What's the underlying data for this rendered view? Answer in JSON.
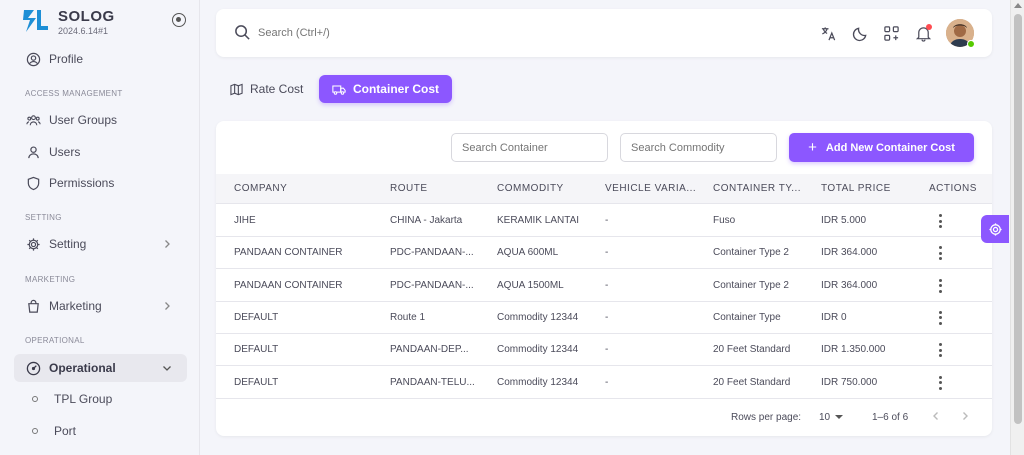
{
  "brand": {
    "name": "SOLOG",
    "version": "2024.6.14#1",
    "logo_text": "SOLOG"
  },
  "sidebar": {
    "items": [
      {
        "label": "Profile",
        "icon": "user-circle-icon"
      },
      {
        "section": "ACCESS MANAGEMENT"
      },
      {
        "label": "User Groups",
        "icon": "users-group-icon"
      },
      {
        "label": "Users",
        "icon": "user-icon"
      },
      {
        "label": "Permissions",
        "icon": "shield-icon"
      },
      {
        "section": "SETTING"
      },
      {
        "label": "Setting",
        "icon": "gear-icon"
      },
      {
        "section": "MARKETING"
      },
      {
        "label": "Marketing",
        "icon": "shopping-bag-icon"
      },
      {
        "section": "OPERATIONAL"
      },
      {
        "label": "Operational",
        "icon": "gauge-icon",
        "active": true
      },
      {
        "label": "TPL Group",
        "sub": true
      },
      {
        "label": "Port",
        "sub": true
      }
    ]
  },
  "topbar": {
    "search_placeholder": "Search (Ctrl+/)"
  },
  "tabs": [
    {
      "label": "Rate Cost",
      "icon": "map-icon",
      "active": false
    },
    {
      "label": "Container Cost",
      "icon": "truck-icon",
      "active": true
    }
  ],
  "filters": {
    "container_placeholder": "Search Container",
    "commodity_placeholder": "Search Commodity",
    "add_button": "Add New Container Cost"
  },
  "table": {
    "columns": [
      "COMPANY",
      "ROUTE",
      "COMMODITY",
      "VEHICLE VARIA...",
      "CONTAINER TY...",
      "TOTAL PRICE",
      "ACTIONS"
    ],
    "rows": [
      [
        "JIHE",
        "CHINA - Jakarta",
        "KERAMIK LANTAI",
        "-",
        "Fuso",
        "IDR 5.000"
      ],
      [
        "PANDAAN CONTAINER",
        "PDC-PANDAAN-...",
        "AQUA 600ML",
        "-",
        "Container Type 2",
        "IDR 364.000"
      ],
      [
        "PANDAAN CONTAINER",
        "PDC-PANDAAN-...",
        "AQUA 1500ML",
        "-",
        "Container Type 2",
        "IDR 364.000"
      ],
      [
        "DEFAULT",
        "Route 1",
        "Commodity 12344",
        "-",
        "Container Type",
        "IDR 0"
      ],
      [
        "DEFAULT",
        "PANDAAN-DEP...",
        "Commodity 12344",
        "-",
        "20 Feet Standard",
        "IDR 1.350.000"
      ],
      [
        "DEFAULT",
        "PANDAAN-TELU...",
        "Commodity 12344",
        "-",
        "20 Feet Standard",
        "IDR 750.000"
      ]
    ]
  },
  "pagination": {
    "rows_per_page_label": "Rows per page:",
    "rows_per_page": "10",
    "range": "1–6 of 6"
  },
  "colors": {
    "primary": "#8c57ff",
    "notification": "#ff4c51",
    "online": "#56ca00"
  }
}
